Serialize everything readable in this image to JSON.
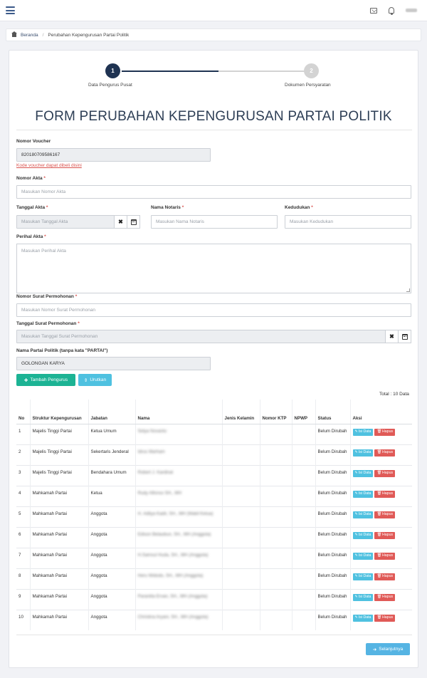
{
  "topbar": {
    "user_name": ""
  },
  "breadcrumb": {
    "home": "Beranda",
    "current": "Perubahan Kepengurusan Partai Politik"
  },
  "stepper": {
    "steps": [
      {
        "number": "1",
        "label": "Data Pengurus Pusat"
      },
      {
        "number": "2",
        "label": "Dokumen Persyaratan"
      }
    ],
    "progress": 0.5
  },
  "form": {
    "title": "FORM PERUBAHAN KEPENGURUSAN PARTAI POLITIK",
    "voucher": {
      "label": "Nomor Voucher",
      "value": "820180709586167",
      "link": "Kode voucher dapat dibeli disini"
    },
    "nomor_akta": {
      "label": "Nomor Akta",
      "placeholder": "Masukan Nomor Akta"
    },
    "tanggal_akta": {
      "label": "Tanggal Akta",
      "placeholder": "Masukan Tanggal Akta"
    },
    "nama_notaris": {
      "label": "Nama Notaris",
      "placeholder": "Masukan Nama Notaris"
    },
    "kedudukan": {
      "label": "Kedudukan",
      "placeholder": "Masukan Kedudukan"
    },
    "perihal_akta": {
      "label": "Perihal Akta",
      "placeholder": "Masukan Perihal Akta"
    },
    "nomor_surat": {
      "label": "Nomor Surat Permohonan",
      "placeholder": "Masukan Nomor Surat Permohonan"
    },
    "tanggal_surat": {
      "label": "Tanggal Surat Permohonan",
      "placeholder": "Masukan Tanggal Surat Permohonan"
    },
    "nama_partai": {
      "label": "Nama Partai Politik (tanpa kata \"PARTAI\")",
      "value": "GOLONGAN KARYA"
    },
    "required_mark": "*"
  },
  "buttons": {
    "tambah": "Tambah Pengurus",
    "urutkan": "Urutkan",
    "selanjutnya": "Selanjutnya",
    "isi_data": "Isi Data",
    "hapus": "Hapus"
  },
  "table": {
    "total": "Total : 10 Data",
    "headers": [
      "No",
      "Struktur Kepengurusan",
      "Jabatan",
      "Nama",
      "Jenis Kelamin",
      "Nomor KTP",
      "NPWP",
      "Status",
      "Aksi"
    ],
    "rows": [
      {
        "no": "1",
        "struktur": "Majelis Tinggi Partai",
        "jabatan": "Ketua Umum",
        "nama": "Setya Novanto",
        "status": "Belum Dirubah"
      },
      {
        "no": "2",
        "struktur": "Majelis Tinggi Partai",
        "jabatan": "Sekertaris Jenderal",
        "nama": "Idrus Marham",
        "status": "Belum Dirubah"
      },
      {
        "no": "3",
        "struktur": "Majelis Tinggi Partai",
        "jabatan": "Bendahara Umum",
        "nama": "Robert J. Kardinal",
        "status": "Belum Dirubah"
      },
      {
        "no": "4",
        "struktur": "Mahkamah Partai",
        "jabatan": "Ketua",
        "nama": "Rudy Alfonso SH., MH",
        "status": "Belum Dirubah"
      },
      {
        "no": "5",
        "struktur": "Mahkamah Partai",
        "jabatan": "Anggota",
        "nama": "H. Aditya Kadir, SH., MH (Wakil Ketua)",
        "status": "Belum Dirubah"
      },
      {
        "no": "6",
        "struktur": "Mahkamah Partai",
        "jabatan": "Anggota",
        "nama": "Edison Betaubun, SH., MH (Anggota)",
        "status": "Belum Dirubah"
      },
      {
        "no": "7",
        "struktur": "Mahkamah Partai",
        "jabatan": "Anggota",
        "nama": "H.Samsul Huda, SH., MH (Anggota)",
        "status": "Belum Dirubah"
      },
      {
        "no": "8",
        "struktur": "Mahkamah Partai",
        "jabatan": "Anggota",
        "nama": "Heru Widodo, SH., MH (Anggota)",
        "status": "Belum Dirubah"
      },
      {
        "no": "9",
        "struktur": "Mahkamah Partai",
        "jabatan": "Anggota",
        "nama": "Paranitia Ervan, SH., MH (Anggota)",
        "status": "Belum Dirubah"
      },
      {
        "no": "10",
        "struktur": "Mahkamah Partai",
        "jabatan": "Anggota",
        "nama": "Christina Aryani, SH., MH (Anggota)",
        "status": "Belum Dirubah"
      }
    ]
  },
  "colors": {
    "navy": "#1f3352",
    "green": "#1cb394",
    "info": "#4fc1e0",
    "danger": "#e05a57",
    "required": "#d9534f"
  }
}
